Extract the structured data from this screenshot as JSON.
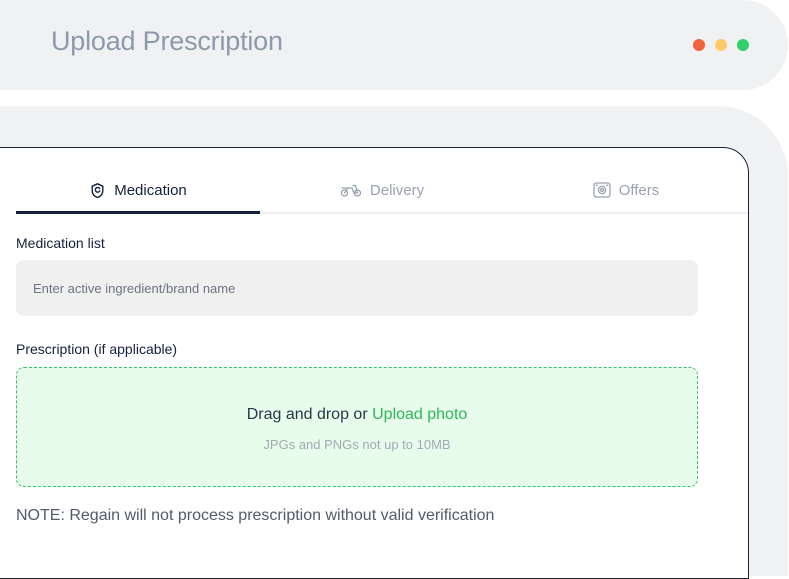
{
  "window": {
    "title": "Upload Prescription",
    "controls": [
      {
        "name": "close",
        "color": "#f2623b"
      },
      {
        "name": "minimize",
        "color": "#fdc969"
      },
      {
        "name": "maximize",
        "color": "#2ed16a"
      }
    ]
  },
  "tabs": [
    {
      "label": "Medication",
      "icon": "medication-icon",
      "active": true
    },
    {
      "label": "Delivery",
      "icon": "motorcycle-icon",
      "active": false
    },
    {
      "label": "Offers",
      "icon": "offers-icon",
      "active": false
    }
  ],
  "medication": {
    "label": "Medication list",
    "placeholder": "Enter active ingredient/brand name",
    "value": ""
  },
  "prescription": {
    "label": "Prescription (if applicable)",
    "drag_text": "Drag and drop or",
    "upload_link": "Upload photo",
    "hint": "JPGs and PNGs not up to 10MB"
  },
  "note": "NOTE: Regain will not process prescription without valid verification",
  "colors": {
    "accent_green": "#2eb85c",
    "active_tab": "#13213c",
    "dropzone_bg": "#e8fcec"
  }
}
